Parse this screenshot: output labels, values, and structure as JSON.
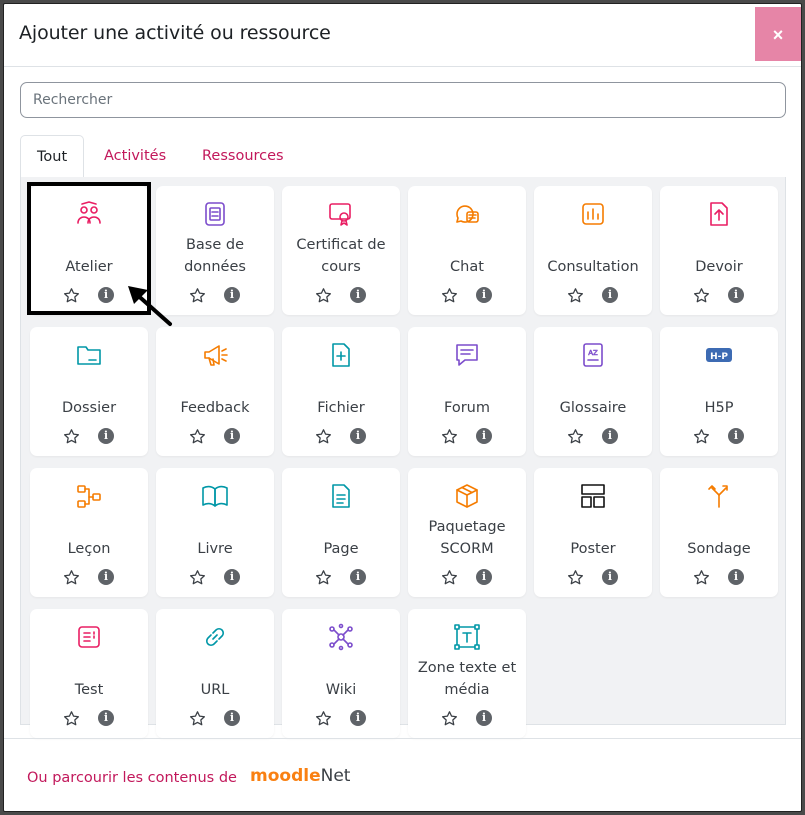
{
  "dialog": {
    "title": "Ajouter une activité ou ressource",
    "close_label": "×"
  },
  "search": {
    "placeholder": "Rechercher"
  },
  "tabs": [
    {
      "label": "Tout",
      "active": true
    },
    {
      "label": "Activités",
      "active": false
    },
    {
      "label": "Ressources",
      "active": false
    }
  ],
  "items": [
    {
      "label": "Atelier",
      "icon": "workshop-icon",
      "color": "#e91e63"
    },
    {
      "label": "Base de données",
      "icon": "database-icon",
      "color": "#7c4dcc"
    },
    {
      "label": "Certificat de cours",
      "icon": "certificate-icon",
      "color": "#e91e63"
    },
    {
      "label": "Chat",
      "icon": "chat-icon",
      "color": "#f57c00"
    },
    {
      "label": "Consultation",
      "icon": "consultation-icon",
      "color": "#f57c00"
    },
    {
      "label": "Devoir",
      "icon": "assignment-icon",
      "color": "#e91e63"
    },
    {
      "label": "Dossier",
      "icon": "folder-icon",
      "color": "#0097a7"
    },
    {
      "label": "Feedback",
      "icon": "megaphone-icon",
      "color": "#f57c00"
    },
    {
      "label": "Fichier",
      "icon": "file-icon",
      "color": "#0097a7"
    },
    {
      "label": "Forum",
      "icon": "forum-icon",
      "color": "#7c4dcc"
    },
    {
      "label": "Glossaire",
      "icon": "glossary-icon",
      "color": "#7c4dcc"
    },
    {
      "label": "H5P",
      "icon": "h5p-icon",
      "color": "#3d6bb3"
    },
    {
      "label": "Leçon",
      "icon": "lesson-icon",
      "color": "#f57c00"
    },
    {
      "label": "Livre",
      "icon": "book-icon",
      "color": "#0097a7"
    },
    {
      "label": "Page",
      "icon": "page-icon",
      "color": "#0097a7"
    },
    {
      "label": "Paquetage SCORM",
      "icon": "package-icon",
      "color": "#f57c00"
    },
    {
      "label": "Poster",
      "icon": "poster-icon",
      "color": "#111111"
    },
    {
      "label": "Sondage",
      "icon": "choice-icon",
      "color": "#f57c00"
    },
    {
      "label": "Test",
      "icon": "quiz-icon",
      "color": "#e91e63"
    },
    {
      "label": "URL",
      "icon": "link-icon",
      "color": "#0097a7"
    },
    {
      "label": "Wiki",
      "icon": "wiki-icon",
      "color": "#7c4dcc"
    },
    {
      "label": "Zone texte et média",
      "icon": "text-media-icon",
      "color": "#0097a7"
    }
  ],
  "footer": {
    "link_text": "Ou parcourir les contenus de",
    "brand_moodle": "moodle",
    "brand_net": "Net"
  },
  "colors": {
    "accent": "#c2185b",
    "close_button": "#e685a7",
    "grid_bg": "#f1f2f4"
  }
}
